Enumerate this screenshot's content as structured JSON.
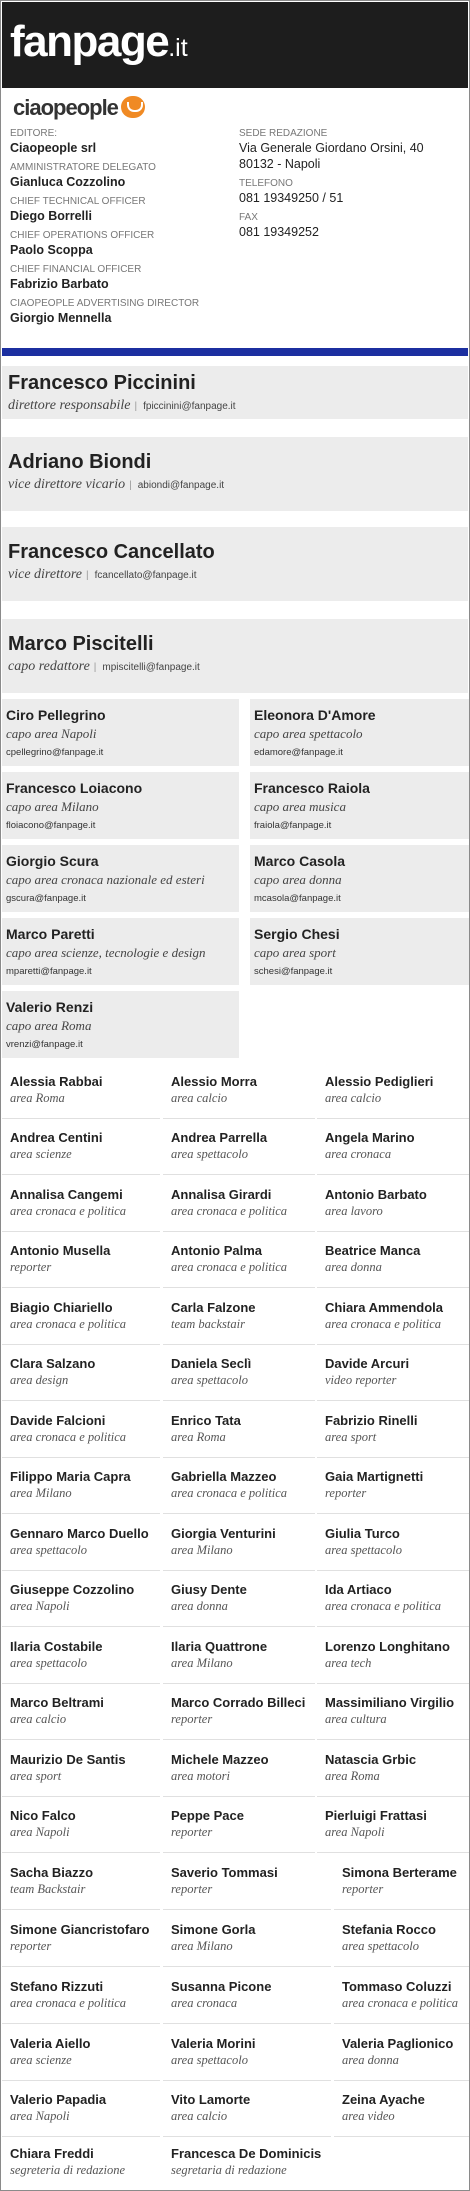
{
  "brand": {
    "name": "fanpage",
    "tld": ".it",
    "publisher_logo": "ciaopeople"
  },
  "publisher_info": {
    "left": [
      {
        "label": "EDITORE:",
        "value": "Ciaopeople srl"
      },
      {
        "label": "AMMINISTRATORE DELEGATO",
        "value": "Gianluca Cozzolino"
      },
      {
        "label": "CHIEF TECHNICAL OFFICER",
        "value": "Diego Borrelli"
      },
      {
        "label": "CHIEF OPERATIONS OFFICER",
        "value": "Paolo Scoppa"
      },
      {
        "label": "CHIEF FINANCIAL OFFICER",
        "value": "Fabrizio Barbato"
      },
      {
        "label": "CIAOPEOPLE ADVERTISING DIRECTOR",
        "value": "Giorgio Mennella"
      }
    ],
    "right": [
      {
        "label": "SEDE REDAZIONE",
        "value": "Via Generale Giordano Orsini, 40",
        "value2": "80132 - Napoli"
      },
      {
        "label": "TELEFONO",
        "value": "081 19349250 / 51"
      },
      {
        "label": "FAX",
        "value": "081 19349252"
      }
    ]
  },
  "leaders": [
    {
      "name": "Francesco Piccinini",
      "role": "direttore responsabile",
      "email": "fpiccinini@fanpage.it"
    },
    {
      "name": "Adriano Biondi",
      "role": "vice direttore vicario",
      "email": "abiondi@fanpage.it"
    },
    {
      "name": "Francesco Cancellato",
      "role": "vice direttore",
      "email": "fcancellato@fanpage.it"
    },
    {
      "name": "Marco Piscitelli",
      "role": "capo redattore",
      "email": "mpiscitelli@fanpage.it"
    }
  ],
  "area_heads": [
    {
      "name": "Ciro Pellegrino",
      "role": "capo area Napoli",
      "email": "cpellegrino@fanpage.it"
    },
    {
      "name": "Eleonora D'Amore",
      "role": "capo area spettacolo",
      "email": "edamore@fanpage.it"
    },
    {
      "name": "Francesco Loiacono",
      "role": "capo area Milano",
      "email": "floiacono@fanpage.it"
    },
    {
      "name": "Francesco Raiola",
      "role": "capo area musica",
      "email": "fraiola@fanpage.it"
    },
    {
      "name": "Giorgio Scura",
      "role": "capo area cronaca nazionale ed esteri",
      "email": "gscura@fanpage.it"
    },
    {
      "name": "Marco Casola",
      "role": "capo area donna",
      "email": "mcasola@fanpage.it"
    },
    {
      "name": "Marco Paretti",
      "role": "capo area scienze, tecnologie e design",
      "email": "mparetti@fanpage.it"
    },
    {
      "name": "Sergio Chesi",
      "role": "capo area sport",
      "email": "schesi@fanpage.it"
    },
    {
      "name": "Valerio Renzi",
      "role": "capo area Roma",
      "email": "vrenzi@fanpage.it"
    }
  ],
  "staff": [
    {
      "name": "Alessia Rabbai",
      "role": "area Roma"
    },
    {
      "name": "Alessio Morra",
      "role": "area calcio"
    },
    {
      "name": "Alessio Pediglieri",
      "role": "area calcio"
    },
    {
      "name": "Andrea Centini",
      "role": "area scienze"
    },
    {
      "name": "Andrea Parrella",
      "role": "area spettacolo"
    },
    {
      "name": "Angela Marino",
      "role": "area cronaca"
    },
    {
      "name": "Annalisa Cangemi",
      "role": "area cronaca e politica"
    },
    {
      "name": "Annalisa Girardi",
      "role": "area cronaca e politica"
    },
    {
      "name": "Antonio Barbato",
      "role": "area lavoro"
    },
    {
      "name": "Antonio Musella",
      "role": "reporter"
    },
    {
      "name": "Antonio Palma",
      "role": "area cronaca e politica"
    },
    {
      "name": "Beatrice Manca",
      "role": "area donna"
    },
    {
      "name": "Biagio Chiariello",
      "role": "area cronaca e politica"
    },
    {
      "name": "Carla Falzone",
      "role": "team backstair"
    },
    {
      "name": "Chiara Ammendola",
      "role": "area cronaca e politica"
    },
    {
      "name": "Clara Salzano",
      "role": "area design"
    },
    {
      "name": "Daniela Seclì",
      "role": "area spettacolo"
    },
    {
      "name": "Davide Arcuri",
      "role": "video reporter"
    },
    {
      "name": "Davide Falcioni",
      "role": "area cronaca e politica"
    },
    {
      "name": "Enrico Tata",
      "role": "area Roma"
    },
    {
      "name": "Fabrizio Rinelli",
      "role": "area sport"
    },
    {
      "name": "Filippo Maria Capra",
      "role": "area Milano"
    },
    {
      "name": "Gabriella Mazzeo",
      "role": "area cronaca e politica"
    },
    {
      "name": "Gaia Martignetti",
      "role": "reporter"
    },
    {
      "name": "Gennaro Marco Duello",
      "role": "area spettacolo"
    },
    {
      "name": "Giorgia Venturini",
      "role": "area Milano"
    },
    {
      "name": "Giulia Turco",
      "role": "area spettacolo"
    },
    {
      "name": "Giuseppe Cozzolino",
      "role": "area Napoli"
    },
    {
      "name": "Giusy Dente",
      "role": "area donna"
    },
    {
      "name": "Ida Artiaco",
      "role": "area cronaca e politica"
    },
    {
      "name": "Ilaria Costabile",
      "role": "area spettacolo"
    },
    {
      "name": "Ilaria Quattrone",
      "role": "area Milano"
    },
    {
      "name": "Lorenzo Longhitano",
      "role": "area tech"
    },
    {
      "name": "Marco Beltrami",
      "role": "area calcio"
    },
    {
      "name": "Marco Corrado Billeci",
      "role": "reporter"
    },
    {
      "name": "Massimiliano Virgilio",
      "role": "area cultura"
    },
    {
      "name": "Maurizio De Santis",
      "role": "area sport"
    },
    {
      "name": "Michele Mazzeo",
      "role": "area motori"
    },
    {
      "name": "Natascia Grbic",
      "role": "area Roma"
    },
    {
      "name": "Nico Falco",
      "role": "area Napoli"
    },
    {
      "name": "Peppe Pace",
      "role": "reporter"
    },
    {
      "name": "Pierluigi Frattasi",
      "role": "area Napoli"
    },
    {
      "name": "Sacha Biazzo",
      "role": "team Backstair"
    },
    {
      "name": "Saverio Tommasi",
      "role": "reporter"
    },
    {
      "name": "Simona Berterame",
      "role": "reporter"
    },
    {
      "name": "Simone Giancristofaro",
      "role": "reporter"
    },
    {
      "name": "Simone Gorla",
      "role": "area Milano"
    },
    {
      "name": "Stefania Rocco",
      "role": "area spettacolo"
    },
    {
      "name": "Stefano Rizzuti",
      "role": "area cronaca e politica"
    },
    {
      "name": "Susanna Picone",
      "role": "area cronaca"
    },
    {
      "name": "Tommaso Coluzzi",
      "role": "area cronaca e politica"
    },
    {
      "name": "Valeria Aiello",
      "role": "area scienze"
    },
    {
      "name": "Valeria Morini",
      "role": "area spettacolo"
    },
    {
      "name": "Valeria Paglionico",
      "role": "area donna"
    },
    {
      "name": "Valerio Papadia",
      "role": "area Napoli"
    },
    {
      "name": "Vito Lamorte",
      "role": "area calcio"
    },
    {
      "name": "Zeina Ayache",
      "role": "area video"
    },
    {
      "name": "Chiara Freddi",
      "role": "segreteria di redazione"
    },
    {
      "name": "Francesca De Dominicis",
      "role": "segretaria di redazione"
    }
  ],
  "colors": {
    "header_bg": "#1d1d1d",
    "accent_bar": "#1c2fa0",
    "box_bg": "#ececec",
    "ciaopeople_orange": "#f08a24"
  },
  "icons": {
    "ciaopeople_logo": "speech-bubble-smile-icon"
  }
}
